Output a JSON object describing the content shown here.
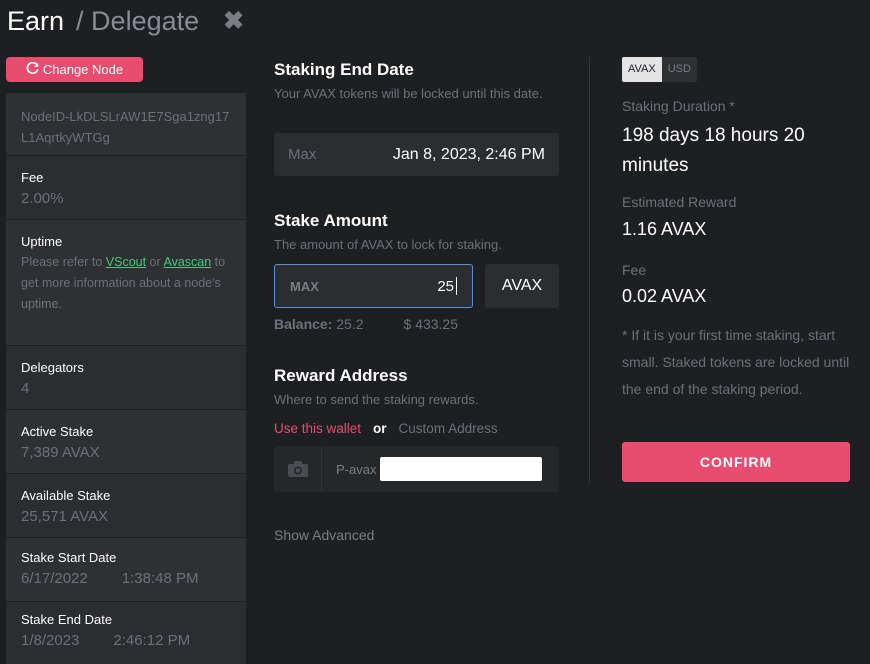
{
  "header": {
    "title": "Earn",
    "subtitle": "/ Delegate",
    "close_glyph": "✖"
  },
  "node": {
    "change_label": "Change Node",
    "node_id": "NodeID-LkDLSLrAW1E7Sga1zng17L1AqrtkyWTGg",
    "fee": {
      "label": "Fee",
      "value": "2.00%"
    },
    "uptime": {
      "label": "Uptime",
      "text_before": "Please refer to ",
      "link1": "VScout",
      "text_mid": " or ",
      "link2": "Avascan",
      "text_after": " to get more information about a node's uptime."
    },
    "delegators": {
      "label": "Delegators",
      "value": "4"
    },
    "active_stake": {
      "label": "Active Stake",
      "value": "7,389 AVAX"
    },
    "available_stake": {
      "label": "Available Stake",
      "value": "25,571 AVAX"
    },
    "start": {
      "label": "Stake Start Date",
      "date": "6/17/2022",
      "time": "1:38:48 PM"
    },
    "end": {
      "label": "Stake End Date",
      "date": "1/8/2023",
      "time": "2:46:12 PM"
    }
  },
  "end_date": {
    "title": "Staking End Date",
    "desc": "Your AVAX tokens will be locked until this date.",
    "max_label": "Max",
    "value": "Jan 8, 2023, 2:46 PM"
  },
  "amount": {
    "title": "Stake Amount",
    "desc": "The amount of AVAX to lock for staking.",
    "max_label": "MAX",
    "value": "25",
    "currency": "AVAX",
    "balance_label": "Balance:",
    "balance_value": "25.2",
    "balance_usd": "$ 433.25"
  },
  "reward": {
    "title": "Reward Address",
    "desc": "Where to send the staking rewards.",
    "use_wallet": "Use this wallet",
    "or": "or",
    "custom": "Custom Address",
    "prefix": "P-avax"
  },
  "show_advanced": "Show Advanced",
  "summary": {
    "currency_active": "AVAX",
    "currency_other": "USD",
    "duration_label": "Staking Duration *",
    "duration_value": "198 days 18 hours 20 minutes",
    "reward_label": "Estimated Reward",
    "reward_value": "1.16 AVAX",
    "fee_label": "Fee",
    "fee_value": "0.02 AVAX",
    "note": "* If it is your first time staking, start small. Staked tokens are locked until the end of the staking period.",
    "confirm": "CONFIRM"
  },
  "colors": {
    "accent": "#e84d6f",
    "link": "#3fcb7b",
    "bg": "#1e1f22",
    "panel": "#2b2d31"
  },
  "icons": [
    "refresh-icon",
    "close-icon",
    "camera-icon"
  ]
}
